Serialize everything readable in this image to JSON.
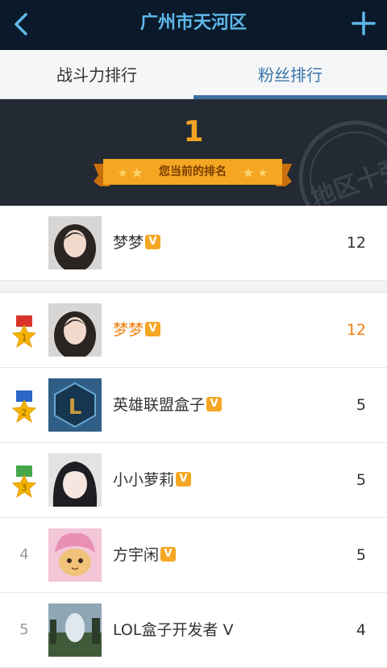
{
  "header": {
    "title": "广州市天河区"
  },
  "tabs": [
    {
      "label": "战斗力排行",
      "active": false
    },
    {
      "label": "粉丝排行",
      "active": true
    }
  ],
  "hero": {
    "rank": "1",
    "ribbon_label": "您当前的排名",
    "stamp_text": "地区十强"
  },
  "me": {
    "name": "梦梦",
    "badge": "V",
    "score": "12"
  },
  "list": [
    {
      "rank": "1",
      "name": "梦梦",
      "badge": "V",
      "score": "12",
      "medal": "gold"
    },
    {
      "rank": "2",
      "name": "英雄联盟盒子",
      "badge": "V",
      "score": "5",
      "medal": "gold"
    },
    {
      "rank": "3",
      "name": "小小萝莉",
      "badge": "V",
      "score": "5",
      "medal": "gold"
    },
    {
      "rank": "4",
      "name": "方宇闲",
      "badge": "V",
      "score": "5"
    },
    {
      "rank": "5",
      "name": "LOL盒子开发者 V",
      "score": "4"
    }
  ],
  "colors": {
    "header_bg": "#0b1a2b",
    "title": "#5fb8ea",
    "highlight": "#f07f10",
    "badge": "#f5a623"
  }
}
